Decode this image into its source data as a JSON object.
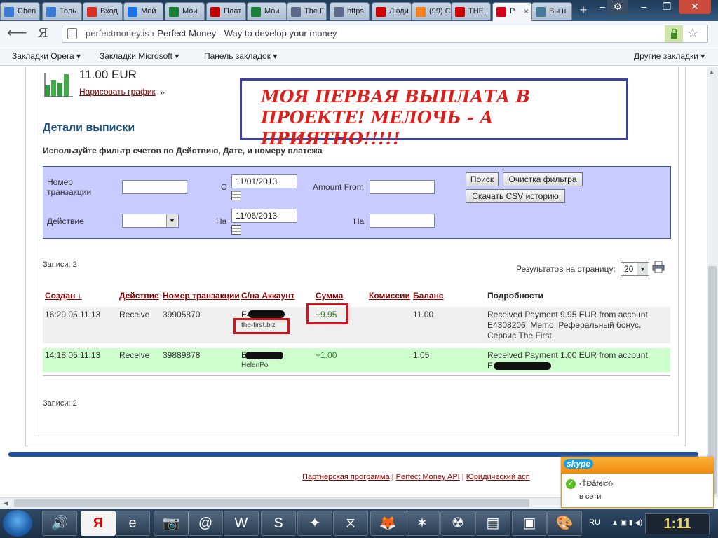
{
  "browser": {
    "tabs": [
      {
        "label": "Chen",
        "color": "#3a7bd5"
      },
      {
        "label": "Толь",
        "color": "#3a7bd5"
      },
      {
        "label": "Вход",
        "color": "#d93025"
      },
      {
        "label": "Мой",
        "color": "#1a73e8"
      },
      {
        "label": "Мои",
        "color": "#188038"
      },
      {
        "label": "Плат",
        "color": "#c00000"
      },
      {
        "label": "Мои",
        "color": "#188038"
      },
      {
        "label": "The F",
        "color": "#5a6a8a"
      },
      {
        "label": "https",
        "color": "#5a6a8a"
      },
      {
        "label": "Люди",
        "color": "#cc0000"
      },
      {
        "label": "(99) С",
        "color": "#f58220"
      },
      {
        "label": "THE I",
        "color": "#cc0000"
      },
      {
        "label": "P",
        "color": "#d0021b"
      },
      {
        "label": "Вы н",
        "color": "#4a7a9a"
      }
    ],
    "active_tab_index": 12,
    "new_tab": "+",
    "back_icon": "back-arrow-icon",
    "yandex_icon": "Я",
    "url_host": "perfectmoney.is",
    "url_separator": " › ",
    "page_title_in_url": "Perfect Money - Way to develop your money",
    "bookmarks": [
      "Закладки Opera ▾",
      "Закладки Microsoft ▾",
      "Панель закладок ▾",
      "Другие закладки ▾"
    ]
  },
  "page": {
    "balance": "11.00 EUR",
    "draw_chart": "Нарисовать график",
    "draw_chart_arrow": "»",
    "callout_line1": "МОЯ ПЕРВАЯ ВЫПЛАТА В",
    "callout_line2": "ПРОЕКТЕ! МЕЛОЧЬ - А ПРИЯТНО!!!!!",
    "section_title": "Детали выписки",
    "filter_hint": "Используйте фильтр счетов по Действию, Дате, и номеру платежа",
    "filter": {
      "tx_label_line1": "Номер",
      "tx_label_line2": "транзакции",
      "tx_value": "",
      "action_label": "Действие",
      "action_value": "",
      "from_label": "С",
      "from_date": "11/01/2013",
      "to_label": "На",
      "to_date": "11/06/2013",
      "amount_from_label": "Amount From",
      "amount_from_value": "",
      "amount_to_label": "На",
      "amount_to_value": "",
      "search_button": "Поиск",
      "clear_button": "Очистка фильтра",
      "csv_button": "Скачать CSV историю"
    },
    "records_count_top": "Записи: 2",
    "records_count_bottom": "Записи: 2",
    "per_page_label": "Результатов на страницу:",
    "per_page_value": "20",
    "table": {
      "headers": {
        "created": "Создан",
        "created_sort": "↓",
        "action": "Действие",
        "tx": "Номер транзакции",
        "account": "С/на Аккаунт",
        "amount": "Сумма",
        "fee": "Комиссии",
        "balance": "Баланс",
        "details": "Подробности"
      },
      "rows": [
        {
          "created": "16:29 05.11.13",
          "action": "Receive",
          "tx": "39905870",
          "account": "E4",
          "account_sub": "the-first.biz",
          "amount": "+9.95",
          "fee": "",
          "balance": "11.00",
          "details_1": "Received Payment 9.95 EUR from account",
          "details_2": "E4308206. Memo: Реферальный бонус.",
          "details_3": "Сервис The First."
        },
        {
          "created": "14:18 05.11.13",
          "action": "Receive",
          "tx": "39889878",
          "account": "E",
          "account_sub": "HelenPol",
          "amount": "+1.00",
          "fee": "",
          "balance": "1.05",
          "details_1": "Received Payment 1.00 EUR from account",
          "details_2": "E"
        }
      ]
    },
    "footer": {
      "partner": "Партнерская программа",
      "sep1": " | ",
      "api": "Perfect Money API",
      "sep2": " | ",
      "legal": "Юридический асп"
    }
  },
  "skype": {
    "logo": "skype",
    "contact_name": "‹ŤÐåfë©ľ›",
    "status": "в сети"
  },
  "taskbar": {
    "apps": [
      "speaker-icon",
      "yandex-browser-icon",
      "internet-explorer-icon",
      "camera-icon",
      "mail-agent-icon",
      "word-icon",
      "skype-icon",
      "puzzle-game-icon",
      "media-player-icon",
      "firefox-icon",
      "star-app-icon",
      "game-icon",
      "folder-icon",
      "presentation-icon",
      "paint-icon"
    ],
    "lang": "RU",
    "time": "1:11"
  },
  "colors": {
    "filter_bg": "#c8cbff",
    "callout_text": "#d9211c",
    "callout_border": "#3b3fa6",
    "highlight_row": "#ccffcc",
    "link_dark_red": "#8b0000",
    "highlight_box": "#d8111b"
  }
}
